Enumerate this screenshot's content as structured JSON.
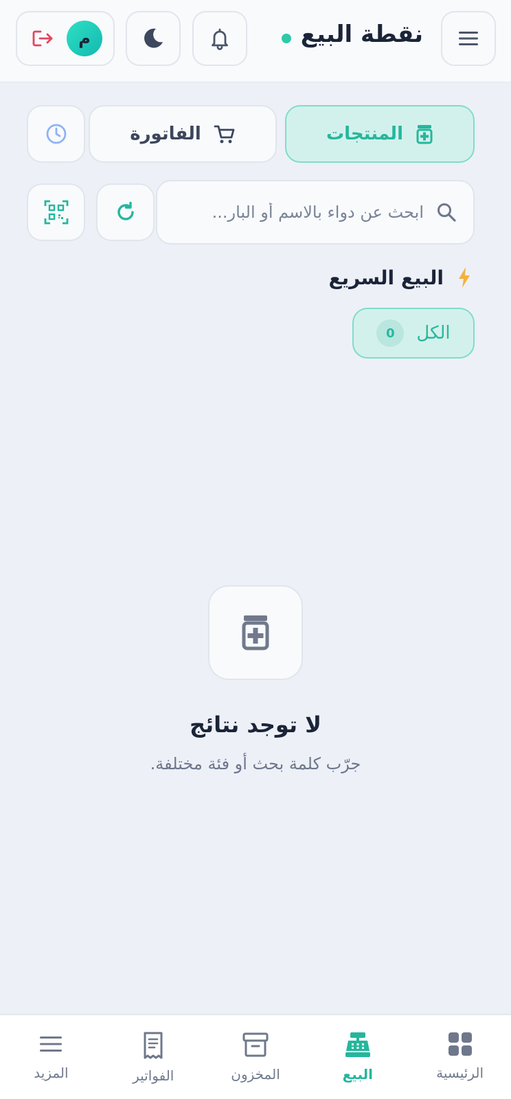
{
  "header": {
    "title": "نقطة البيع",
    "avatar_initial": "م",
    "icons": {
      "menu": "menu-icon",
      "bell": "bell-icon",
      "moon": "moon-icon",
      "logout": "logout-icon"
    }
  },
  "tabs": {
    "products_label": "المنتجات",
    "invoice_label": "الفاتورة"
  },
  "search": {
    "placeholder": "ابحث عن دواء بالاسم أو البار...",
    "value": ""
  },
  "quick_sale": {
    "title": "البيع السريع",
    "chips": [
      {
        "label": "الكل",
        "count": "0"
      }
    ]
  },
  "empty_state": {
    "title": "لا توجد نتائج",
    "subtitle": "جرّب كلمة بحث أو فئة مختلفة."
  },
  "bottom_nav": {
    "items": [
      {
        "label": "الرئيسية",
        "icon": "grid-icon",
        "active": false
      },
      {
        "label": "البيع",
        "icon": "cash-register-icon",
        "active": true
      },
      {
        "label": "المخزون",
        "icon": "archive-icon",
        "active": false
      },
      {
        "label": "الفواتير",
        "icon": "receipt-icon",
        "active": false
      },
      {
        "label": "المزيد",
        "icon": "menu-icon",
        "active": false
      }
    ]
  },
  "colors": {
    "accent": "#24b79d",
    "accent_bg": "#d3f1ec",
    "background": "#edf0f7",
    "logout_red": "#e2455f"
  }
}
